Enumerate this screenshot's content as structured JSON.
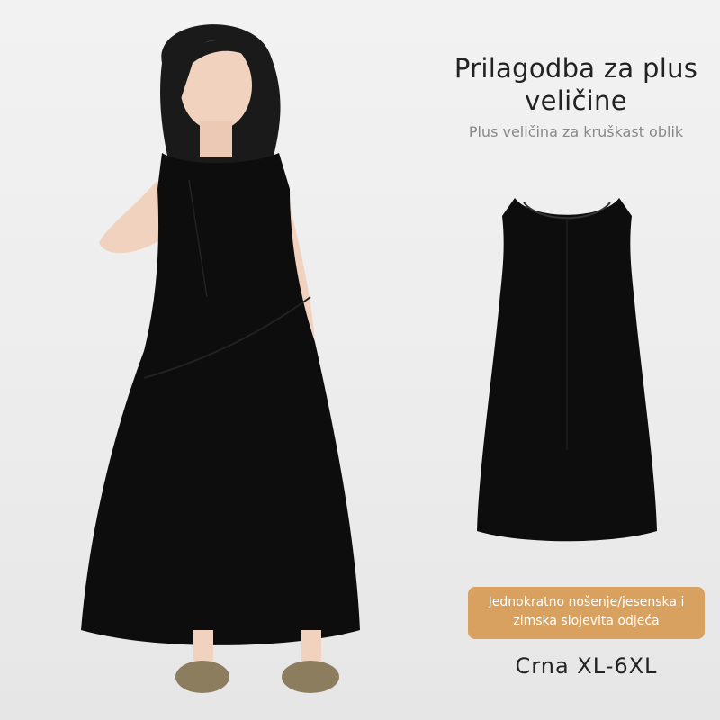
{
  "texts": {
    "headline": "Prilagodba za plus veličine",
    "subline": "Plus veličina za kruškast oblik",
    "badge": "Jednokratno nošenje/jesenska i zimska slojevita odjeća",
    "size_label": "Crna XL-6XL"
  },
  "colors": {
    "background": "#eeeeee",
    "dress": "#0d0d0d",
    "badge": "#d9a15f",
    "shoes": "#8d7d5f"
  }
}
